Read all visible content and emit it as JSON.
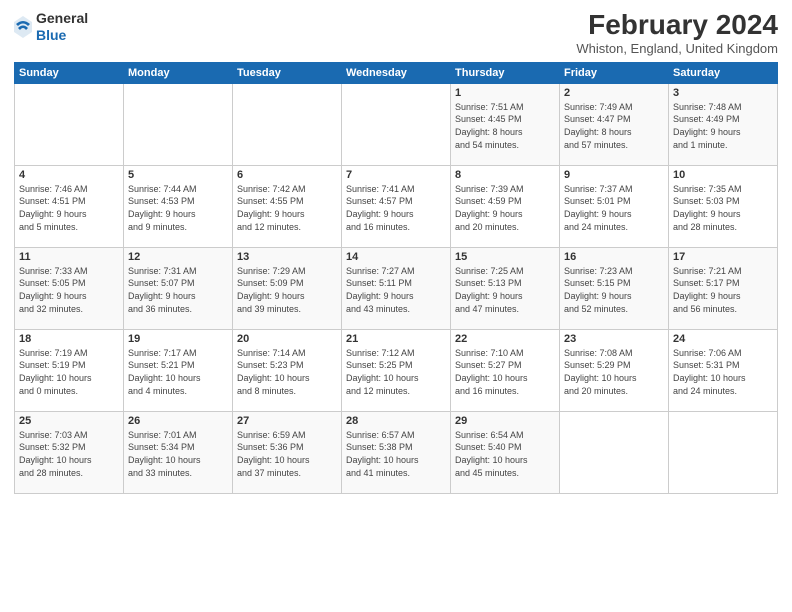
{
  "logo": {
    "general": "General",
    "blue": "Blue"
  },
  "header": {
    "title": "February 2024",
    "subtitle": "Whiston, England, United Kingdom"
  },
  "days_of_week": [
    "Sunday",
    "Monday",
    "Tuesday",
    "Wednesday",
    "Thursday",
    "Friday",
    "Saturday"
  ],
  "weeks": [
    [
      {
        "day": "",
        "info": ""
      },
      {
        "day": "",
        "info": ""
      },
      {
        "day": "",
        "info": ""
      },
      {
        "day": "",
        "info": ""
      },
      {
        "day": "1",
        "info": "Sunrise: 7:51 AM\nSunset: 4:45 PM\nDaylight: 8 hours\nand 54 minutes."
      },
      {
        "day": "2",
        "info": "Sunrise: 7:49 AM\nSunset: 4:47 PM\nDaylight: 8 hours\nand 57 minutes."
      },
      {
        "day": "3",
        "info": "Sunrise: 7:48 AM\nSunset: 4:49 PM\nDaylight: 9 hours\nand 1 minute."
      }
    ],
    [
      {
        "day": "4",
        "info": "Sunrise: 7:46 AM\nSunset: 4:51 PM\nDaylight: 9 hours\nand 5 minutes."
      },
      {
        "day": "5",
        "info": "Sunrise: 7:44 AM\nSunset: 4:53 PM\nDaylight: 9 hours\nand 9 minutes."
      },
      {
        "day": "6",
        "info": "Sunrise: 7:42 AM\nSunset: 4:55 PM\nDaylight: 9 hours\nand 12 minutes."
      },
      {
        "day": "7",
        "info": "Sunrise: 7:41 AM\nSunset: 4:57 PM\nDaylight: 9 hours\nand 16 minutes."
      },
      {
        "day": "8",
        "info": "Sunrise: 7:39 AM\nSunset: 4:59 PM\nDaylight: 9 hours\nand 20 minutes."
      },
      {
        "day": "9",
        "info": "Sunrise: 7:37 AM\nSunset: 5:01 PM\nDaylight: 9 hours\nand 24 minutes."
      },
      {
        "day": "10",
        "info": "Sunrise: 7:35 AM\nSunset: 5:03 PM\nDaylight: 9 hours\nand 28 minutes."
      }
    ],
    [
      {
        "day": "11",
        "info": "Sunrise: 7:33 AM\nSunset: 5:05 PM\nDaylight: 9 hours\nand 32 minutes."
      },
      {
        "day": "12",
        "info": "Sunrise: 7:31 AM\nSunset: 5:07 PM\nDaylight: 9 hours\nand 36 minutes."
      },
      {
        "day": "13",
        "info": "Sunrise: 7:29 AM\nSunset: 5:09 PM\nDaylight: 9 hours\nand 39 minutes."
      },
      {
        "day": "14",
        "info": "Sunrise: 7:27 AM\nSunset: 5:11 PM\nDaylight: 9 hours\nand 43 minutes."
      },
      {
        "day": "15",
        "info": "Sunrise: 7:25 AM\nSunset: 5:13 PM\nDaylight: 9 hours\nand 47 minutes."
      },
      {
        "day": "16",
        "info": "Sunrise: 7:23 AM\nSunset: 5:15 PM\nDaylight: 9 hours\nand 52 minutes."
      },
      {
        "day": "17",
        "info": "Sunrise: 7:21 AM\nSunset: 5:17 PM\nDaylight: 9 hours\nand 56 minutes."
      }
    ],
    [
      {
        "day": "18",
        "info": "Sunrise: 7:19 AM\nSunset: 5:19 PM\nDaylight: 10 hours\nand 0 minutes."
      },
      {
        "day": "19",
        "info": "Sunrise: 7:17 AM\nSunset: 5:21 PM\nDaylight: 10 hours\nand 4 minutes."
      },
      {
        "day": "20",
        "info": "Sunrise: 7:14 AM\nSunset: 5:23 PM\nDaylight: 10 hours\nand 8 minutes."
      },
      {
        "day": "21",
        "info": "Sunrise: 7:12 AM\nSunset: 5:25 PM\nDaylight: 10 hours\nand 12 minutes."
      },
      {
        "day": "22",
        "info": "Sunrise: 7:10 AM\nSunset: 5:27 PM\nDaylight: 10 hours\nand 16 minutes."
      },
      {
        "day": "23",
        "info": "Sunrise: 7:08 AM\nSunset: 5:29 PM\nDaylight: 10 hours\nand 20 minutes."
      },
      {
        "day": "24",
        "info": "Sunrise: 7:06 AM\nSunset: 5:31 PM\nDaylight: 10 hours\nand 24 minutes."
      }
    ],
    [
      {
        "day": "25",
        "info": "Sunrise: 7:03 AM\nSunset: 5:32 PM\nDaylight: 10 hours\nand 28 minutes."
      },
      {
        "day": "26",
        "info": "Sunrise: 7:01 AM\nSunset: 5:34 PM\nDaylight: 10 hours\nand 33 minutes."
      },
      {
        "day": "27",
        "info": "Sunrise: 6:59 AM\nSunset: 5:36 PM\nDaylight: 10 hours\nand 37 minutes."
      },
      {
        "day": "28",
        "info": "Sunrise: 6:57 AM\nSunset: 5:38 PM\nDaylight: 10 hours\nand 41 minutes."
      },
      {
        "day": "29",
        "info": "Sunrise: 6:54 AM\nSunset: 5:40 PM\nDaylight: 10 hours\nand 45 minutes."
      },
      {
        "day": "",
        "info": ""
      },
      {
        "day": "",
        "info": ""
      }
    ]
  ]
}
